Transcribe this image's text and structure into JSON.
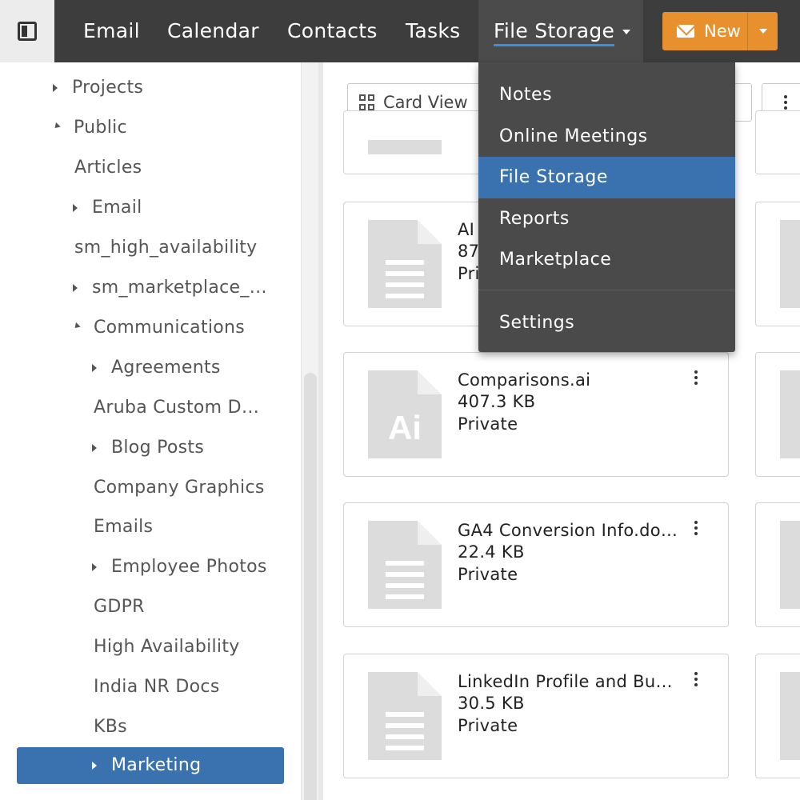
{
  "nav": {
    "items": [
      {
        "label": "Email"
      },
      {
        "label": "Calendar"
      },
      {
        "label": "Contacts"
      },
      {
        "label": "Tasks"
      },
      {
        "label": "File Storage"
      }
    ],
    "new_label": "New"
  },
  "sidebar": {
    "items": [
      {
        "label": "Projects"
      },
      {
        "label": "Public"
      },
      {
        "label": "Articles"
      },
      {
        "label": "Email"
      },
      {
        "label": "sm_high_availability"
      },
      {
        "label": "sm_marketplace_…"
      },
      {
        "label": "Communications"
      },
      {
        "label": "Agreements"
      },
      {
        "label": "Aruba Custom D…"
      },
      {
        "label": "Blog Posts"
      },
      {
        "label": "Company Graphics"
      },
      {
        "label": "Emails"
      },
      {
        "label": "Employee Photos"
      },
      {
        "label": "GDPR"
      },
      {
        "label": "High Availability"
      },
      {
        "label": "India NR Docs"
      },
      {
        "label": "KBs"
      },
      {
        "label": "Marketing"
      }
    ]
  },
  "toolbar": {
    "view_label": "Card View"
  },
  "dropdown": {
    "items": [
      {
        "label": "Notes"
      },
      {
        "label": "Online Meetings"
      },
      {
        "label": "File Storage"
      },
      {
        "label": "Reports"
      },
      {
        "label": "Marketplace"
      },
      {
        "label": "Settings"
      }
    ]
  },
  "files": [
    {
      "name": "AI",
      "size": "87",
      "visibility": "Pri"
    },
    {
      "name": "Comparisons.ai",
      "size": "407.3 KB",
      "visibility": "Private",
      "icon_text": "Ai"
    },
    {
      "name": "GA4 Conversion Info.do…",
      "size": "22.4 KB",
      "visibility": "Private"
    },
    {
      "name": "LinkedIn Profile and Bu…",
      "size": "30.5 KB",
      "visibility": "Private"
    }
  ],
  "colors": {
    "topbar": "#3d3d3d",
    "accent_blue": "#3a72b0",
    "new_button": "#e8902d",
    "underline": "#3b8fe0"
  }
}
